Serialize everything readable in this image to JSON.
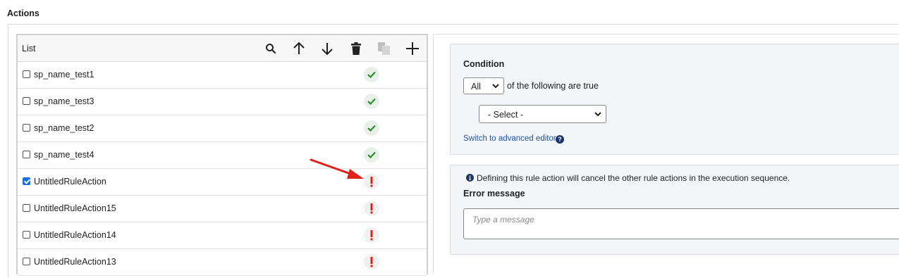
{
  "section_title": "Actions",
  "list": {
    "header_label": "List",
    "toolbar": [
      {
        "name": "search-icon"
      },
      {
        "name": "arrow-up-icon"
      },
      {
        "name": "arrow-down-icon"
      },
      {
        "name": "trash-icon"
      },
      {
        "name": "copy-icon"
      },
      {
        "name": "plus-icon"
      }
    ],
    "items": [
      {
        "label": "sp_name_test1",
        "checked": false,
        "status": "ok"
      },
      {
        "label": "sp_name_test3",
        "checked": false,
        "status": "ok"
      },
      {
        "label": "sp_name_test2",
        "checked": false,
        "status": "ok"
      },
      {
        "label": "sp_name_test4",
        "checked": false,
        "status": "ok"
      },
      {
        "label": "UntitledRuleAction",
        "checked": true,
        "status": "error"
      },
      {
        "label": "UntitledRuleAction15",
        "checked": false,
        "status": "error"
      },
      {
        "label": "UntitledRuleAction14",
        "checked": false,
        "status": "error"
      },
      {
        "label": "UntitledRuleAction13",
        "checked": false,
        "status": "error"
      }
    ]
  },
  "condition": {
    "title": "Condition",
    "match_value": "All",
    "match_suffix": "of the following are true",
    "select_value": "- Select -",
    "advanced_link": "Switch to advanced editor",
    "help_glyph": "?"
  },
  "error_panel": {
    "info_glyph": "i",
    "info_text": "Defining this rule action will cancel the other rule actions in the execution sequence.",
    "title": "Error message",
    "placeholder": "Type a message"
  },
  "colors": {
    "ok": "#2e8b2e",
    "error": "#e0201a",
    "link": "#1f55a6",
    "annotation_arrow": "#e0201a"
  }
}
